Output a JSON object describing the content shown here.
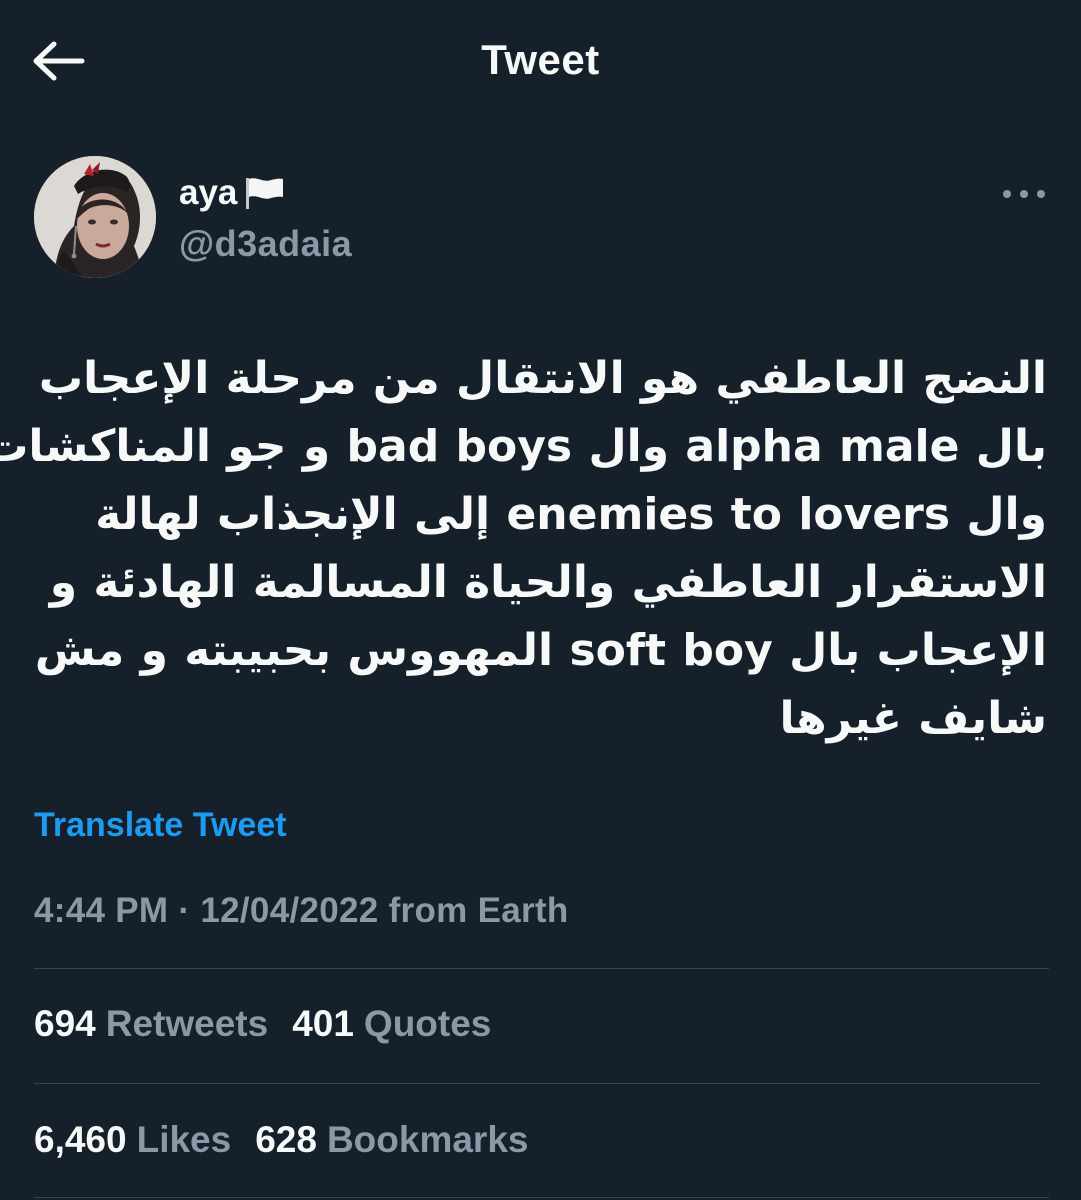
{
  "header": {
    "title": "Tweet",
    "back_icon": "arrow-left-icon"
  },
  "author": {
    "display_name": "aya",
    "flag_icon": "white-flag-icon",
    "username": "@d3adaia",
    "more_icon": "more-horizontal-icon"
  },
  "tweet": {
    "lines": [
      "النضج العاطفي هو الانتقال من مرحلة الإعجاب",
      "بال alpha male وال bad boys و جو المناكشات",
      "وال enemies to lovers إلى الإنجذاب لهالة",
      "الاستقرار العاطفي والحياة المسالمة الهادئة و",
      "الإعجاب بال soft boy المهووس بحبيبته و مش",
      "شايف غيرها"
    ],
    "translate_label": "Translate Tweet",
    "timestamp": "4:44 PM · 12/04/2022 from Earth"
  },
  "stats": {
    "retweets_count": "694",
    "retweets_label": "Retweets",
    "quotes_count": "401",
    "quotes_label": "Quotes",
    "likes_count": "6,460",
    "likes_label": "Likes",
    "bookmarks_count": "628",
    "bookmarks_label": "Bookmarks"
  },
  "colors": {
    "background": "#15202b",
    "text": "#f7f9f9",
    "secondary": "#8b98a5",
    "accent": "#1d9bf0",
    "divider": "#38444d"
  }
}
